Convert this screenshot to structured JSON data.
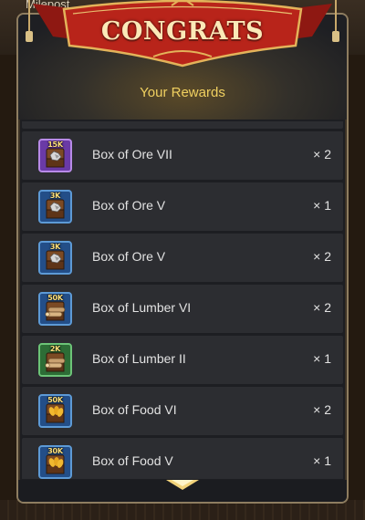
{
  "background": {
    "label": "Milepost"
  },
  "dialog": {
    "banner_title": "CONGRATS",
    "subtitle": "Your Rewards",
    "rewards": [
      {
        "name": "Box of Ore VII",
        "count": "× 2",
        "tag": "15K",
        "rarity": "purple",
        "type": "ore"
      },
      {
        "name": "Box of Ore V",
        "count": "× 1",
        "tag": "3K",
        "rarity": "blue",
        "type": "ore"
      },
      {
        "name": "Box of Ore V",
        "count": "× 2",
        "tag": "3K",
        "rarity": "blue",
        "type": "ore"
      },
      {
        "name": "Box of Lumber VI",
        "count": "× 2",
        "tag": "50K",
        "rarity": "blue",
        "type": "lumber"
      },
      {
        "name": "Box of Lumber II",
        "count": "× 1",
        "tag": "2K",
        "rarity": "green",
        "type": "lumber"
      },
      {
        "name": "Box of Food VI",
        "count": "× 2",
        "tag": "50K",
        "rarity": "blue",
        "type": "food"
      },
      {
        "name": "Box of Food V",
        "count": "× 1",
        "tag": "30K",
        "rarity": "blue",
        "type": "food"
      }
    ]
  },
  "colors": {
    "banner_red": "#b8241a",
    "subtitle_gold": "#f0d060",
    "row_bg": "#2c2d31"
  }
}
